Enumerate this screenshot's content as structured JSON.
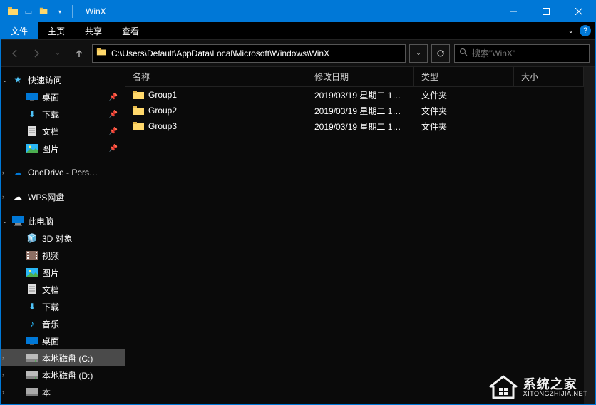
{
  "title": "WinX",
  "tabs": {
    "file": "文件",
    "home": "主页",
    "share": "共享",
    "view": "查看"
  },
  "address": "C:\\Users\\Default\\AppData\\Local\\Microsoft\\Windows\\WinX",
  "search_placeholder": "搜索\"WinX\"",
  "columns": {
    "name": "名称",
    "date": "修改日期",
    "type": "类型",
    "size": "大小"
  },
  "nav": {
    "quick_access": "快速访问",
    "desktop": "桌面",
    "downloads": "下载",
    "documents": "文档",
    "pictures": "图片",
    "onedrive": "OneDrive - Pers…",
    "wps": "WPS网盘",
    "this_pc": "此电脑",
    "objects3d": "3D 对象",
    "videos": "视频",
    "pc_pictures": "图片",
    "pc_documents": "文档",
    "pc_downloads": "下载",
    "music": "音乐",
    "pc_desktop": "桌面",
    "drive_c": "本地磁盘 (C:)",
    "drive_d": "本地磁盘 (D:)",
    "drive_e_partial": "本"
  },
  "files": [
    {
      "name": "Group1",
      "date": "2019/03/19 星期二 1…",
      "type": "文件夹",
      "size": ""
    },
    {
      "name": "Group2",
      "date": "2019/03/19 星期二 1…",
      "type": "文件夹",
      "size": ""
    },
    {
      "name": "Group3",
      "date": "2019/03/19 星期二 1…",
      "type": "文件夹",
      "size": ""
    }
  ],
  "watermark": {
    "cn": "系统之家",
    "en": "XITONGZHIJIA.NET"
  }
}
